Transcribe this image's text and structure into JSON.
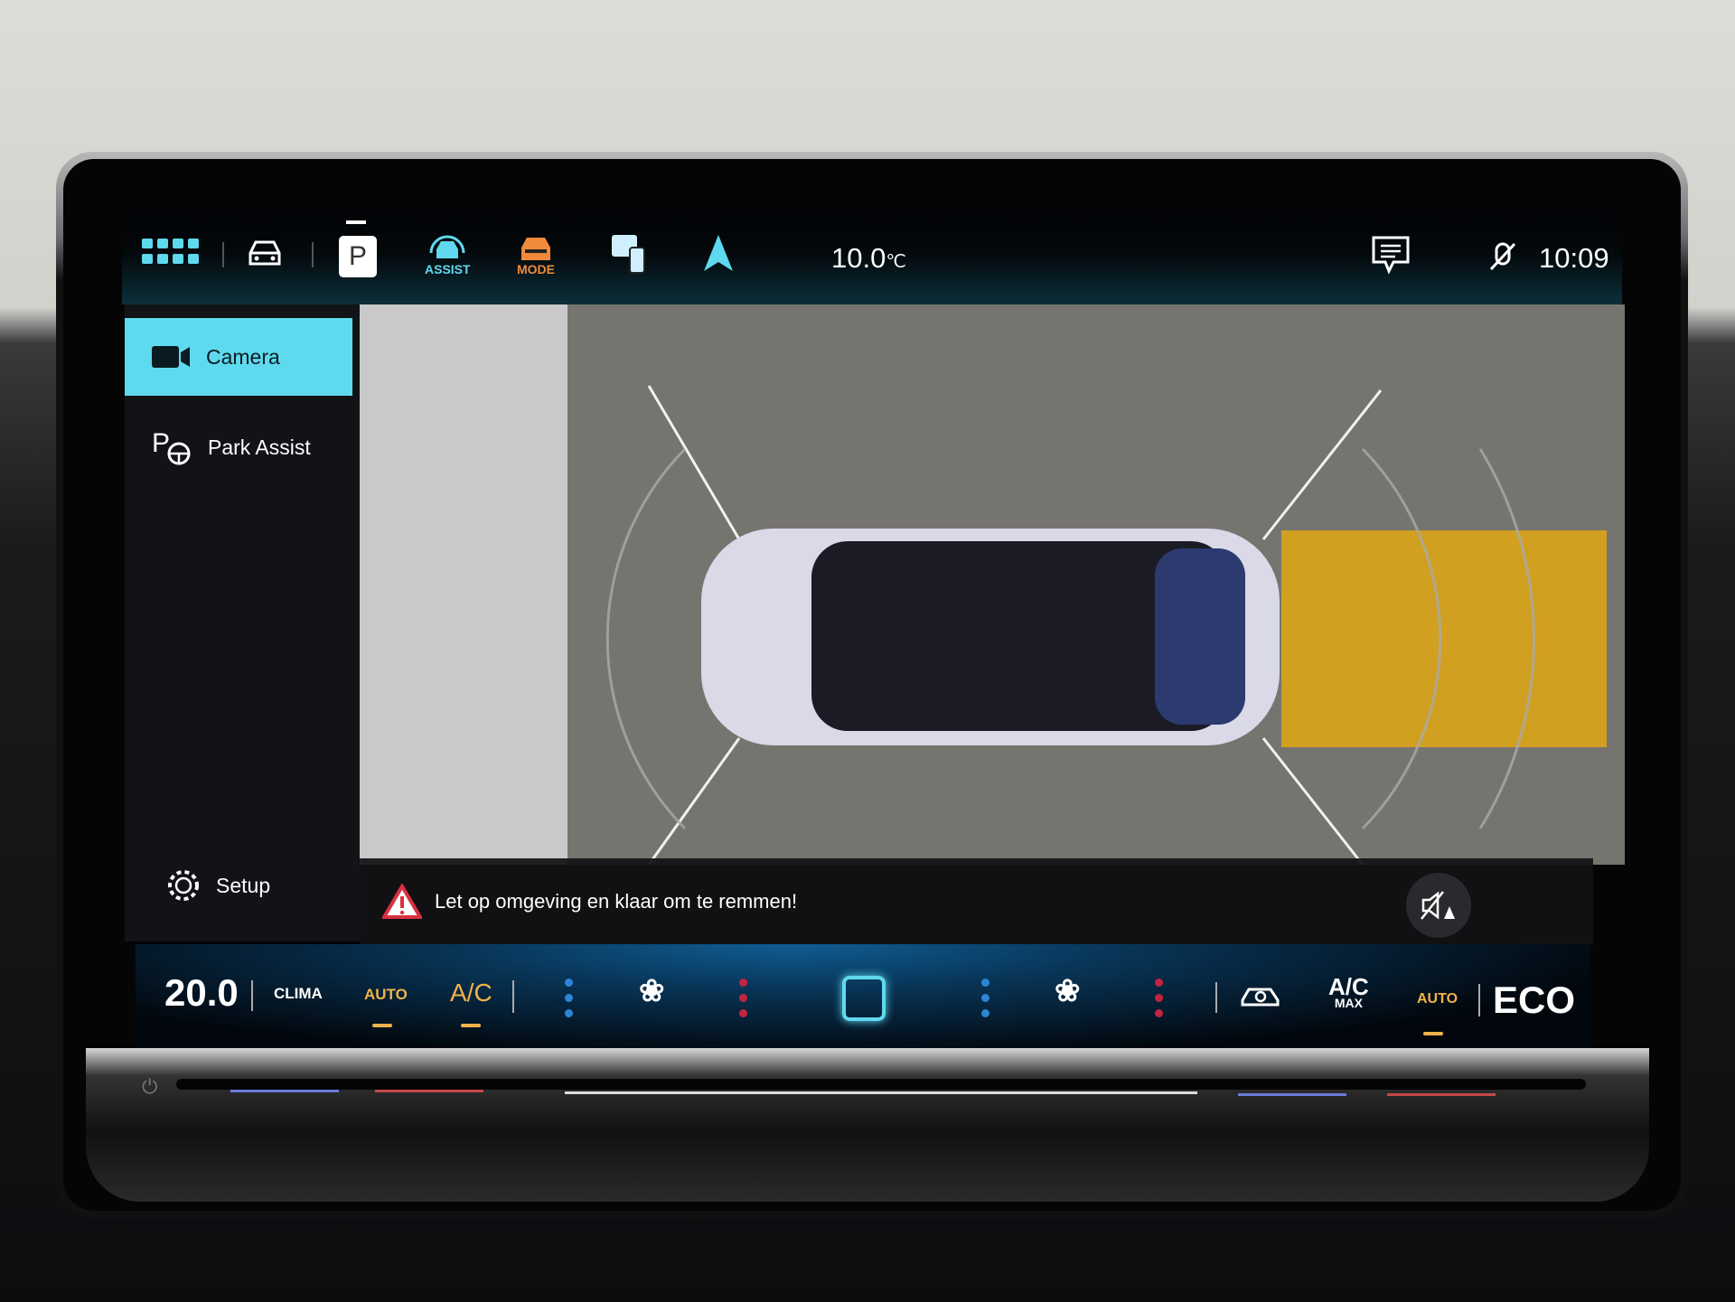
{
  "topbar": {
    "icons": [
      "apps-grid-icon",
      "vehicle-icon",
      "park-p-icon",
      "assist-icon",
      "mode-icon",
      "phone-projection-icon",
      "navigation-arrow-icon",
      "message-icon",
      "mic-muted-icon"
    ],
    "p_label": "P",
    "assist_label": "ASSIST",
    "mode_label": "MODE",
    "temperature": "10.0",
    "temp_unit": "℃",
    "clock": "10:09"
  },
  "sidebar": {
    "items": [
      {
        "label": "Camera",
        "icon": "camera-icon",
        "active": true
      },
      {
        "label": "Park Assist",
        "icon": "park-assist-icon",
        "active": false
      }
    ],
    "setup_label": "Setup"
  },
  "camera": {
    "warning": "Let op omgeving en klaar om te remmen!",
    "obstacle_zone_color": "#e3a814"
  },
  "clima": {
    "temp_left": "20.0",
    "clima_label": "CLIMA",
    "auto_left": "AUTO",
    "ac_label": "A/C",
    "ac_max_top": "A/C",
    "ac_max_bottom": "MAX",
    "auto_right": "AUTO",
    "eco_label": "ECO"
  },
  "colors": {
    "accent": "#5fd9ee",
    "orange": "#f08a3a",
    "amber": "#f2b24a",
    "blue_dot": "#2b86d8",
    "red_dot": "#c3233f"
  }
}
